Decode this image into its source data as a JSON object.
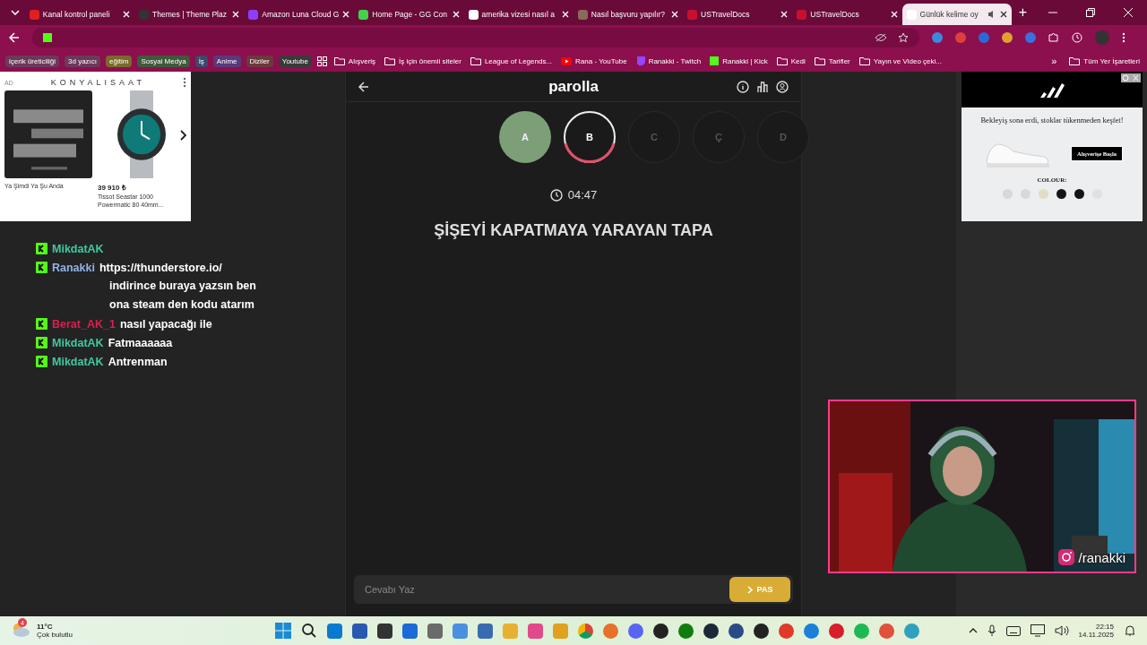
{
  "browser": {
    "tabs": [
      {
        "title": "Kanal kontrol paneli",
        "selected": false
      },
      {
        "title": "Themes | Theme Plaz",
        "selected": false
      },
      {
        "title": "Amazon Luna Cloud G",
        "selected": false
      },
      {
        "title": "Home Page - GG Con",
        "selected": false
      },
      {
        "title": "amerika vizesi nasıl a",
        "selected": false
      },
      {
        "title": "Nasıl başvuru yapılır?",
        "selected": false
      },
      {
        "title": "USTravelDocs",
        "selected": false
      },
      {
        "title": "USTravelDocs",
        "selected": false
      },
      {
        "title": "Günlük kelime oy",
        "selected": true
      }
    ],
    "new_tab": "+",
    "bookmark_chips": [
      {
        "label": "içerik üreticiliği",
        "color": "#6b3a5a"
      },
      {
        "label": "3d yazıcı",
        "color": "#6b3a5a"
      },
      {
        "label": "eğitim",
        "color": "#7a6a2a"
      },
      {
        "label": "Sosyal Medya",
        "color": "#3f5a3a"
      },
      {
        "label": "İş",
        "color": "#3a4a6a"
      },
      {
        "label": "Anime",
        "color": "#5a3a7a"
      },
      {
        "label": "Diziler",
        "color": "#6a3a3a"
      },
      {
        "label": "Youtube",
        "color": "#3a3a3a"
      }
    ],
    "bookmarks": [
      {
        "label": "Alışveriş",
        "kind": "folder"
      },
      {
        "label": "İş için önemli siteler",
        "kind": "folder"
      },
      {
        "label": "League of Legends...",
        "kind": "folder"
      },
      {
        "label": "Rana - YouTube",
        "kind": "youtube"
      },
      {
        "label": "Ranakki - Twitch",
        "kind": "twitch"
      },
      {
        "label": "Ranakki | Kick",
        "kind": "kick"
      },
      {
        "label": "Kedi",
        "kind": "folder"
      },
      {
        "label": "Tarifler",
        "kind": "folder"
      },
      {
        "label": "Yayın ve Video çeki...",
        "kind": "folder"
      }
    ],
    "more": "»",
    "all_bookmarks": "Tüm Yer İşaretleri"
  },
  "left_ad": {
    "tag": "AD",
    "brand": "KONYALISAAT",
    "products": [
      {
        "title": "Ya Şimdi Ya Şu Anda"
      },
      {
        "price": "39 910 ₺",
        "title": "Tissot Seastar 1000 Powermatic 80 40mm..."
      }
    ]
  },
  "game": {
    "title": "parolla",
    "letters": [
      {
        "letter": "A",
        "correct": true,
        "selected": false
      },
      {
        "letter": "B",
        "correct": false,
        "selected": true
      },
      {
        "letter": "C",
        "correct": false,
        "selected": false
      },
      {
        "letter": "Ç",
        "correct": false,
        "selected": false
      },
      {
        "letter": "D",
        "correct": false,
        "selected": false
      }
    ],
    "timer": "04:47",
    "question": "ŞİŞEYİ KAPATMAYA YARAYAN TAPA",
    "answer": {
      "placeholder": "Cevabı Yaz"
    },
    "pass_button": "PAS"
  },
  "right_ad": {
    "headline": "Bekleyiş sona erdi, stoklar tükenmeden keşfet!",
    "button": "Alışverişe Başla",
    "colour_label": "COLOUR:",
    "swatches": [
      {
        "color": "#d6d9dc"
      },
      {
        "color": "#d6d9dc"
      },
      {
        "color": "#e0ddc6"
      },
      {
        "color": "#111418"
      },
      {
        "color": "#111418"
      },
      {
        "color": "#dfe2e5"
      }
    ]
  },
  "chat": [
    {
      "user": "MikdatAK",
      "color": "#3ec9a0"
    },
    {
      "user": "Ranakki",
      "color": "#8fb4e8",
      "lines": [
        "https://thunderstore.io/",
        "indirince buraya yazsın ben",
        "ona steam den kodu atarım"
      ]
    },
    {
      "user": "Berat_AK_1",
      "color": "#d8204e",
      "lines": [
        "nasıl yapacağı ile"
      ]
    },
    {
      "user": "MikdatAK",
      "color": "#3ec9a0",
      "lines": [
        "Fatmaaaaaa"
      ]
    },
    {
      "user": "MikdatAK",
      "color": "#3ec9a0",
      "lines": [
        "Antrenman"
      ]
    }
  ],
  "webcam": {
    "handle": "/ranakki"
  },
  "taskbar": {
    "weather_badge": "4",
    "temperature": "11°C",
    "condition": "Çok bulutlu",
    "time": "22:15",
    "date": "14.11.2025"
  }
}
